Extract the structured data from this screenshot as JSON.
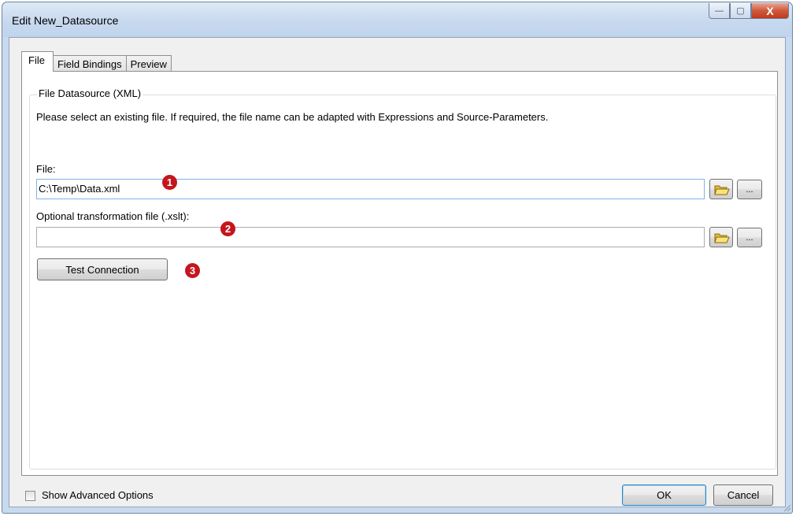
{
  "window": {
    "title": "Edit New_Datasource",
    "minimize_symbol": "—",
    "maximize_symbol": "▢",
    "close_symbol": "X"
  },
  "tabs": [
    {
      "label": "File",
      "active": true
    },
    {
      "label": "Field Bindings",
      "active": false
    },
    {
      "label": "Preview",
      "active": false
    }
  ],
  "group": {
    "title": "File Datasource (XML)",
    "description": "Please select an existing file. If required, the file name can be adapted with Expressions and Source-Parameters."
  },
  "file": {
    "label": "File:",
    "value": "C:\\Temp\\Data.xml",
    "browse_icon": "folder-open-icon",
    "ellipsis_label": "..."
  },
  "transform": {
    "label": "Optional transformation file (.xslt):",
    "value": "",
    "browse_icon": "folder-open-icon",
    "ellipsis_label": "..."
  },
  "test_button": {
    "label": "Test Connection"
  },
  "callouts": [
    "1",
    "2",
    "3"
  ],
  "footer": {
    "advanced_label": "Show Advanced Options",
    "advanced_checked": false,
    "ok_label": "OK",
    "cancel_label": "Cancel"
  },
  "colors": {
    "callout": "#c4161c",
    "window_frame": "#c9daee",
    "close_button": "#c0391b"
  }
}
